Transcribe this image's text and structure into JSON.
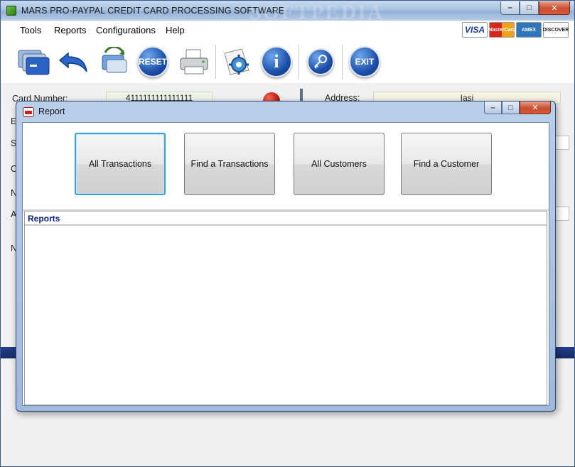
{
  "main_window": {
    "title": "MARS PRO-PAYPAL CREDIT CARD PROCESSING SOFTWARE",
    "watermark": "SOFTPEDIA",
    "menu": [
      "Tools",
      "Reports",
      "Configurations",
      "Help"
    ],
    "card_logos": [
      "VISA",
      "MasterCard",
      "AMEX",
      "DISCOVER"
    ],
    "toolbar": [
      {
        "icon": "cards-icon"
      },
      {
        "icon": "undo-arrow-icon"
      },
      {
        "icon": "refresh-cards-icon"
      },
      {
        "icon": "reset-icon",
        "label": "RESET"
      },
      {
        "icon": "printer-icon"
      },
      {
        "icon": "settings-gear-icon"
      },
      {
        "icon": "info-icon"
      },
      {
        "icon": "key-icon"
      },
      {
        "icon": "exit-icon",
        "label": "EXIT"
      }
    ],
    "form": {
      "card_number_label": "Card Number:",
      "card_number_value": "4111111111111111",
      "address_label": "Address:",
      "address_value": "Iasi",
      "partial_labels": [
        "E",
        "S",
        "C",
        "N",
        "A",
        "N"
      ]
    }
  },
  "dialog": {
    "title": "Report",
    "buttons": [
      "All Transactions",
      "Find a Transactions",
      "All Customers",
      "Find a Customer"
    ],
    "panel_header": "Reports"
  },
  "colors": {
    "title_bar": "#a9c2e2",
    "dialog_frame": "#b9cfea",
    "reports_header_text": "#0a1e7a",
    "focus_border": "#3c9fd5",
    "close_button": "#c74d2f"
  }
}
